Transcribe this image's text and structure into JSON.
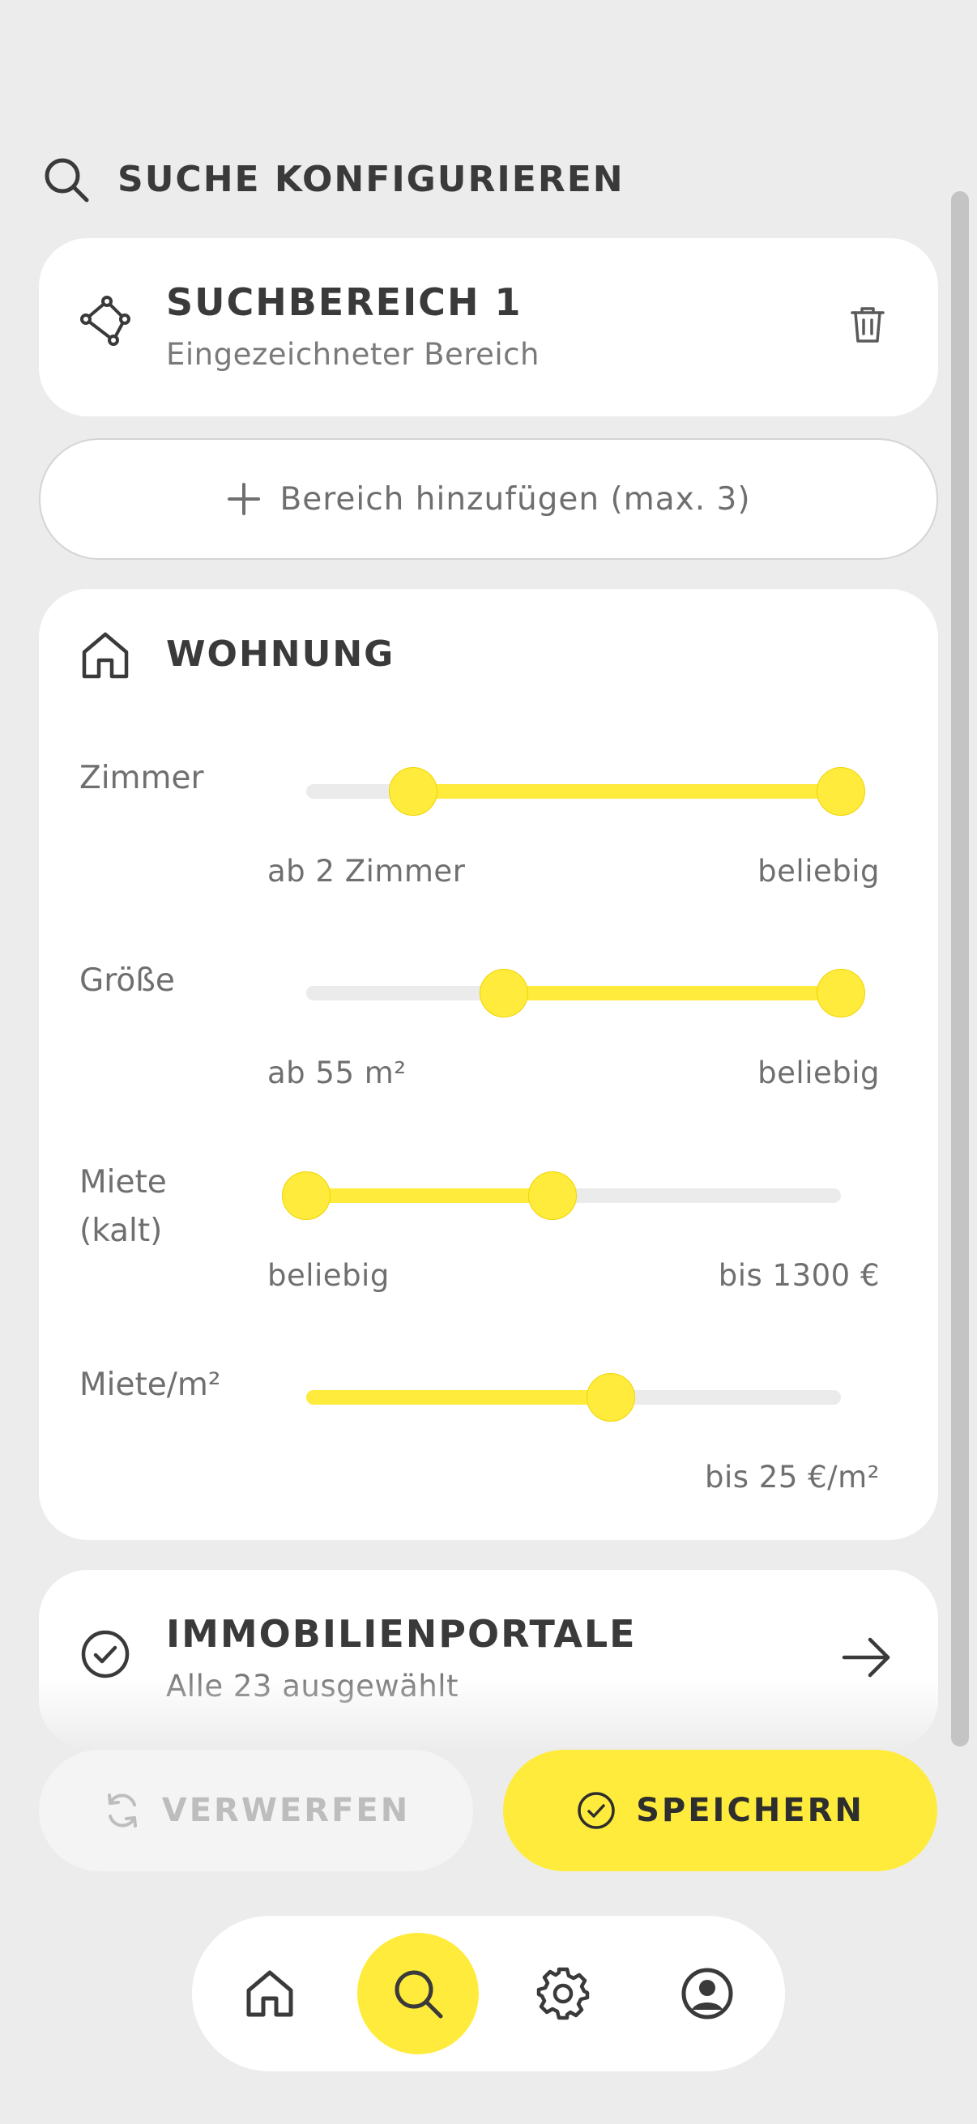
{
  "header": {
    "title": "SUCHE KONFIGURIEREN",
    "icon": "search-icon"
  },
  "search_area": {
    "title": "SUCHBEREICH 1",
    "subtitle": "Eingezeichneter Bereich",
    "icon": "polygon-icon",
    "delete_icon": "trash-icon"
  },
  "add_area": {
    "label": "Bereich hinzufügen (max. 3)",
    "icon": "plus-icon"
  },
  "apartment": {
    "title": "WOHNUNG",
    "icon": "house-icon",
    "filters": [
      {
        "label": "Zimmer",
        "min_text": "ab 2 Zimmer",
        "max_text": "beliebig",
        "range_fraction": [
          0.2,
          1.0
        ]
      },
      {
        "label": "Größe",
        "min_text": "ab 55 m²",
        "max_text": "beliebig",
        "range_fraction": [
          0.37,
          1.0
        ]
      },
      {
        "label": "Miete (kalt)",
        "min_text": "beliebig",
        "max_text": "bis 1300 €",
        "range_fraction": [
          0.0,
          0.46
        ]
      },
      {
        "label": "Miete/m²",
        "min_text": "",
        "max_text": "bis 25 €/m²",
        "range_fraction": [
          0.57
        ]
      }
    ]
  },
  "portals": {
    "title": "IMMOBILIENPORTALE",
    "subtitle": "Alle 23 ausgewählt",
    "icon": "check-circle-icon",
    "action_icon": "arrow-right-icon"
  },
  "actions": {
    "discard_label": "VERWERFEN",
    "save_label": "SPEICHERN"
  },
  "nav": {
    "items": [
      "home-icon",
      "search-icon",
      "gear-icon",
      "account-icon"
    ],
    "active": "search-icon"
  },
  "colors": {
    "accent": "#ffeb3b",
    "background": "#ececec",
    "card": "#ffffff",
    "text": "#3a3a3a",
    "muted": "#6f6f6f"
  }
}
